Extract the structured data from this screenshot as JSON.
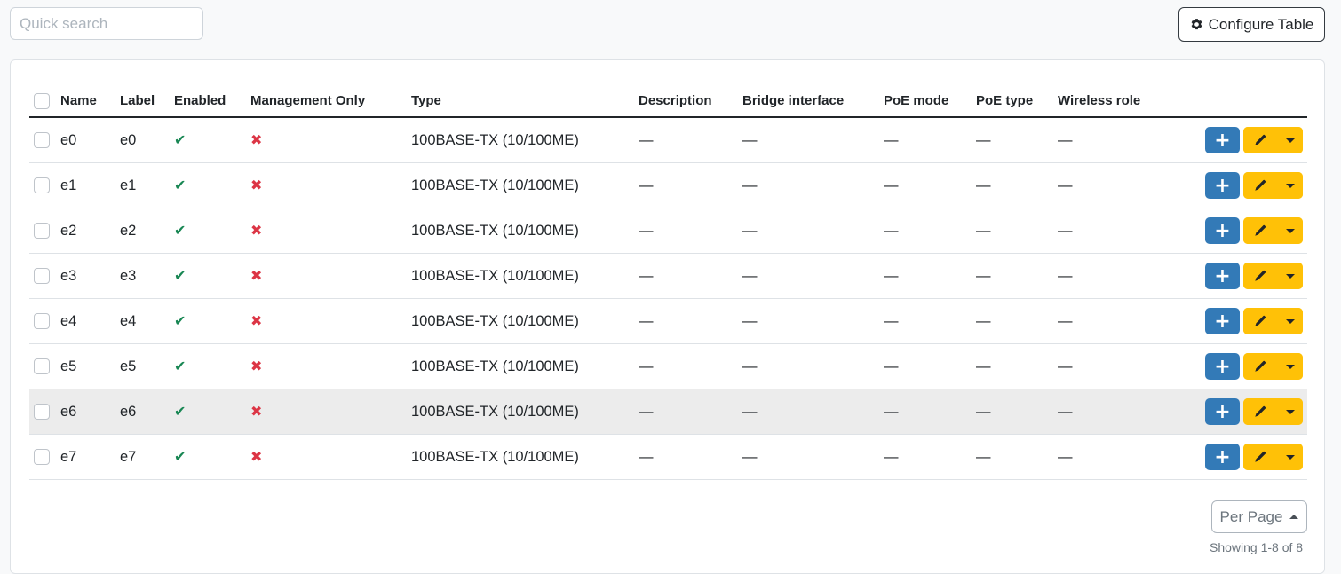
{
  "search": {
    "placeholder": "Quick search"
  },
  "toolbar": {
    "configure_label": "Configure Table"
  },
  "table": {
    "columns": [
      "Name",
      "Label",
      "Enabled",
      "Management Only",
      "Type",
      "Description",
      "Bridge interface",
      "PoE mode",
      "PoE type",
      "Wireless role"
    ],
    "rows": [
      {
        "name": "e0",
        "label": "e0",
        "enabled": true,
        "mgmt_only": false,
        "type": "100BASE-TX (10/100ME)",
        "description": "—",
        "bridge": "—",
        "poe_mode": "—",
        "poe_type": "—",
        "wireless_role": "—"
      },
      {
        "name": "e1",
        "label": "e1",
        "enabled": true,
        "mgmt_only": false,
        "type": "100BASE-TX (10/100ME)",
        "description": "—",
        "bridge": "—",
        "poe_mode": "—",
        "poe_type": "—",
        "wireless_role": "—"
      },
      {
        "name": "e2",
        "label": "e2",
        "enabled": true,
        "mgmt_only": false,
        "type": "100BASE-TX (10/100ME)",
        "description": "—",
        "bridge": "—",
        "poe_mode": "—",
        "poe_type": "—",
        "wireless_role": "—"
      },
      {
        "name": "e3",
        "label": "e3",
        "enabled": true,
        "mgmt_only": false,
        "type": "100BASE-TX (10/100ME)",
        "description": "—",
        "bridge": "—",
        "poe_mode": "—",
        "poe_type": "—",
        "wireless_role": "—"
      },
      {
        "name": "e4",
        "label": "e4",
        "enabled": true,
        "mgmt_only": false,
        "type": "100BASE-TX (10/100ME)",
        "description": "—",
        "bridge": "—",
        "poe_mode": "—",
        "poe_type": "—",
        "wireless_role": "—"
      },
      {
        "name": "e5",
        "label": "e5",
        "enabled": true,
        "mgmt_only": false,
        "type": "100BASE-TX (10/100ME)",
        "description": "—",
        "bridge": "—",
        "poe_mode": "—",
        "poe_type": "—",
        "wireless_role": "—"
      },
      {
        "name": "e6",
        "label": "e6",
        "enabled": true,
        "mgmt_only": false,
        "type": "100BASE-TX (10/100ME)",
        "description": "—",
        "bridge": "—",
        "poe_mode": "—",
        "poe_type": "—",
        "wireless_role": "—"
      },
      {
        "name": "e7",
        "label": "e7",
        "enabled": true,
        "mgmt_only": false,
        "type": "100BASE-TX (10/100ME)",
        "description": "—",
        "bridge": "—",
        "poe_mode": "—",
        "poe_type": "—",
        "wireless_role": "—"
      }
    ],
    "highlighted_row": "e6"
  },
  "icons": {
    "check": "✔",
    "cross": "✖",
    "add": "+",
    "configure": "gear-icon",
    "edit": "pencil-icon"
  },
  "colors": {
    "add_button": "#337ab7",
    "edit_button": "#ffc107",
    "enabled_true": "#198754",
    "enabled_false": "#dc3545",
    "row_highlight": "#ececec"
  },
  "pagination": {
    "per_page_label": "Per Page",
    "showing_text": "Showing 1-8 of 8"
  }
}
